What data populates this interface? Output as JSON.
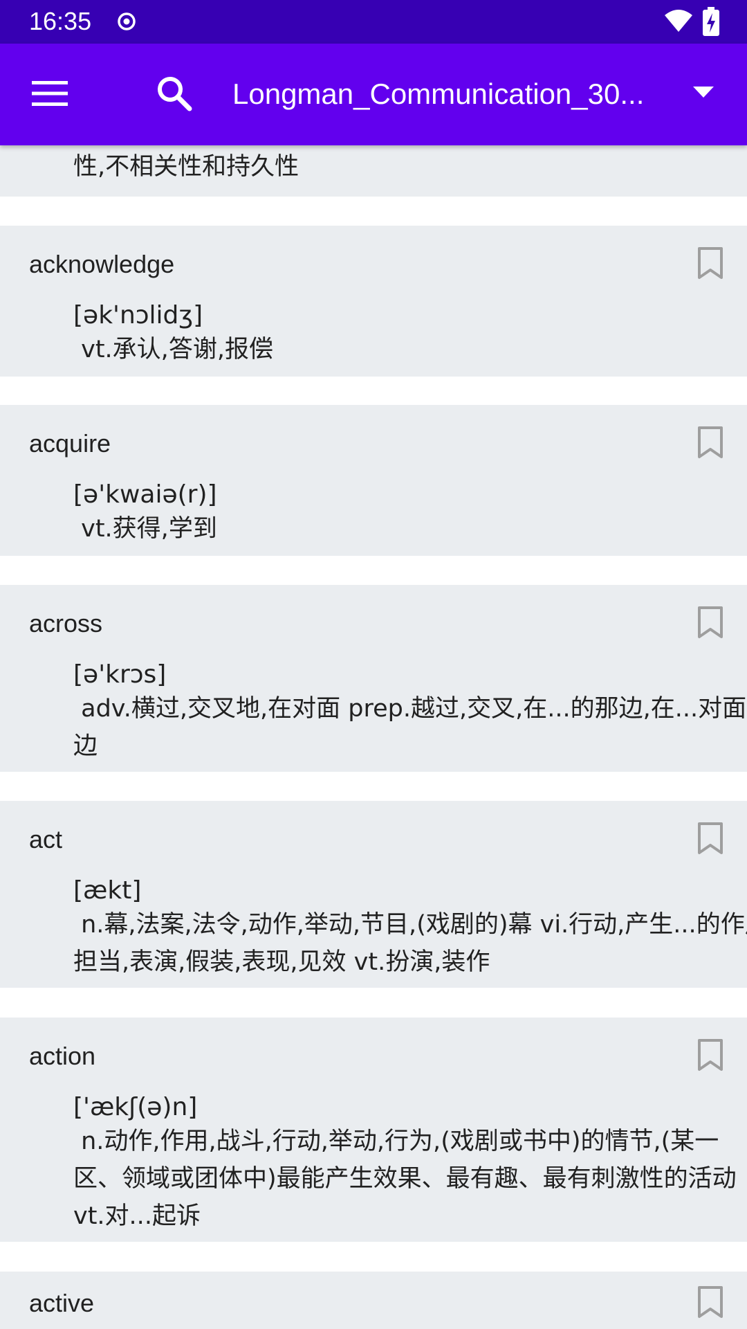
{
  "status_bar": {
    "time": "16:35"
  },
  "app_bar": {
    "dictionary_title": "Longman_Communication_30..."
  },
  "partial_entry": {
    "definition_tail": "性,不相关性和持久性"
  },
  "entries": [
    {
      "word": "acknowledge",
      "phonetic": "[ək'nɔlidʒ]",
      "definition": " vt.承认,答谢,报偿"
    },
    {
      "word": "acquire",
      "phonetic": "[ə'kwaiə(r)]",
      "definition": " vt.获得,学到"
    },
    {
      "word": "across",
      "phonetic": "[ə'krɔs]",
      "definition": " adv.横过,交叉地,在对面 prep.越过,交叉,在...的那边,在...对面\n边"
    },
    {
      "word": "act",
      "phonetic": "[ækt]",
      "definition": " n.幕,法案,法令,动作,举动,节目,(戏剧的)幕 vi.行动,产生...的作用\n担当,表演,假装,表现,见效 vt.扮演,装作"
    },
    {
      "word": "action",
      "phonetic": "['ækʃ(ə)n]",
      "definition": " n.动作,作用,战斗,行动,举动,行为,(戏剧或书中)的情节,(某一\n区、领域或团体中)最能产生效果、最有趣、最有刺激性的活动\nvt.对...起诉"
    },
    {
      "word": "active",
      "phonetic": "",
      "definition": ""
    }
  ]
}
